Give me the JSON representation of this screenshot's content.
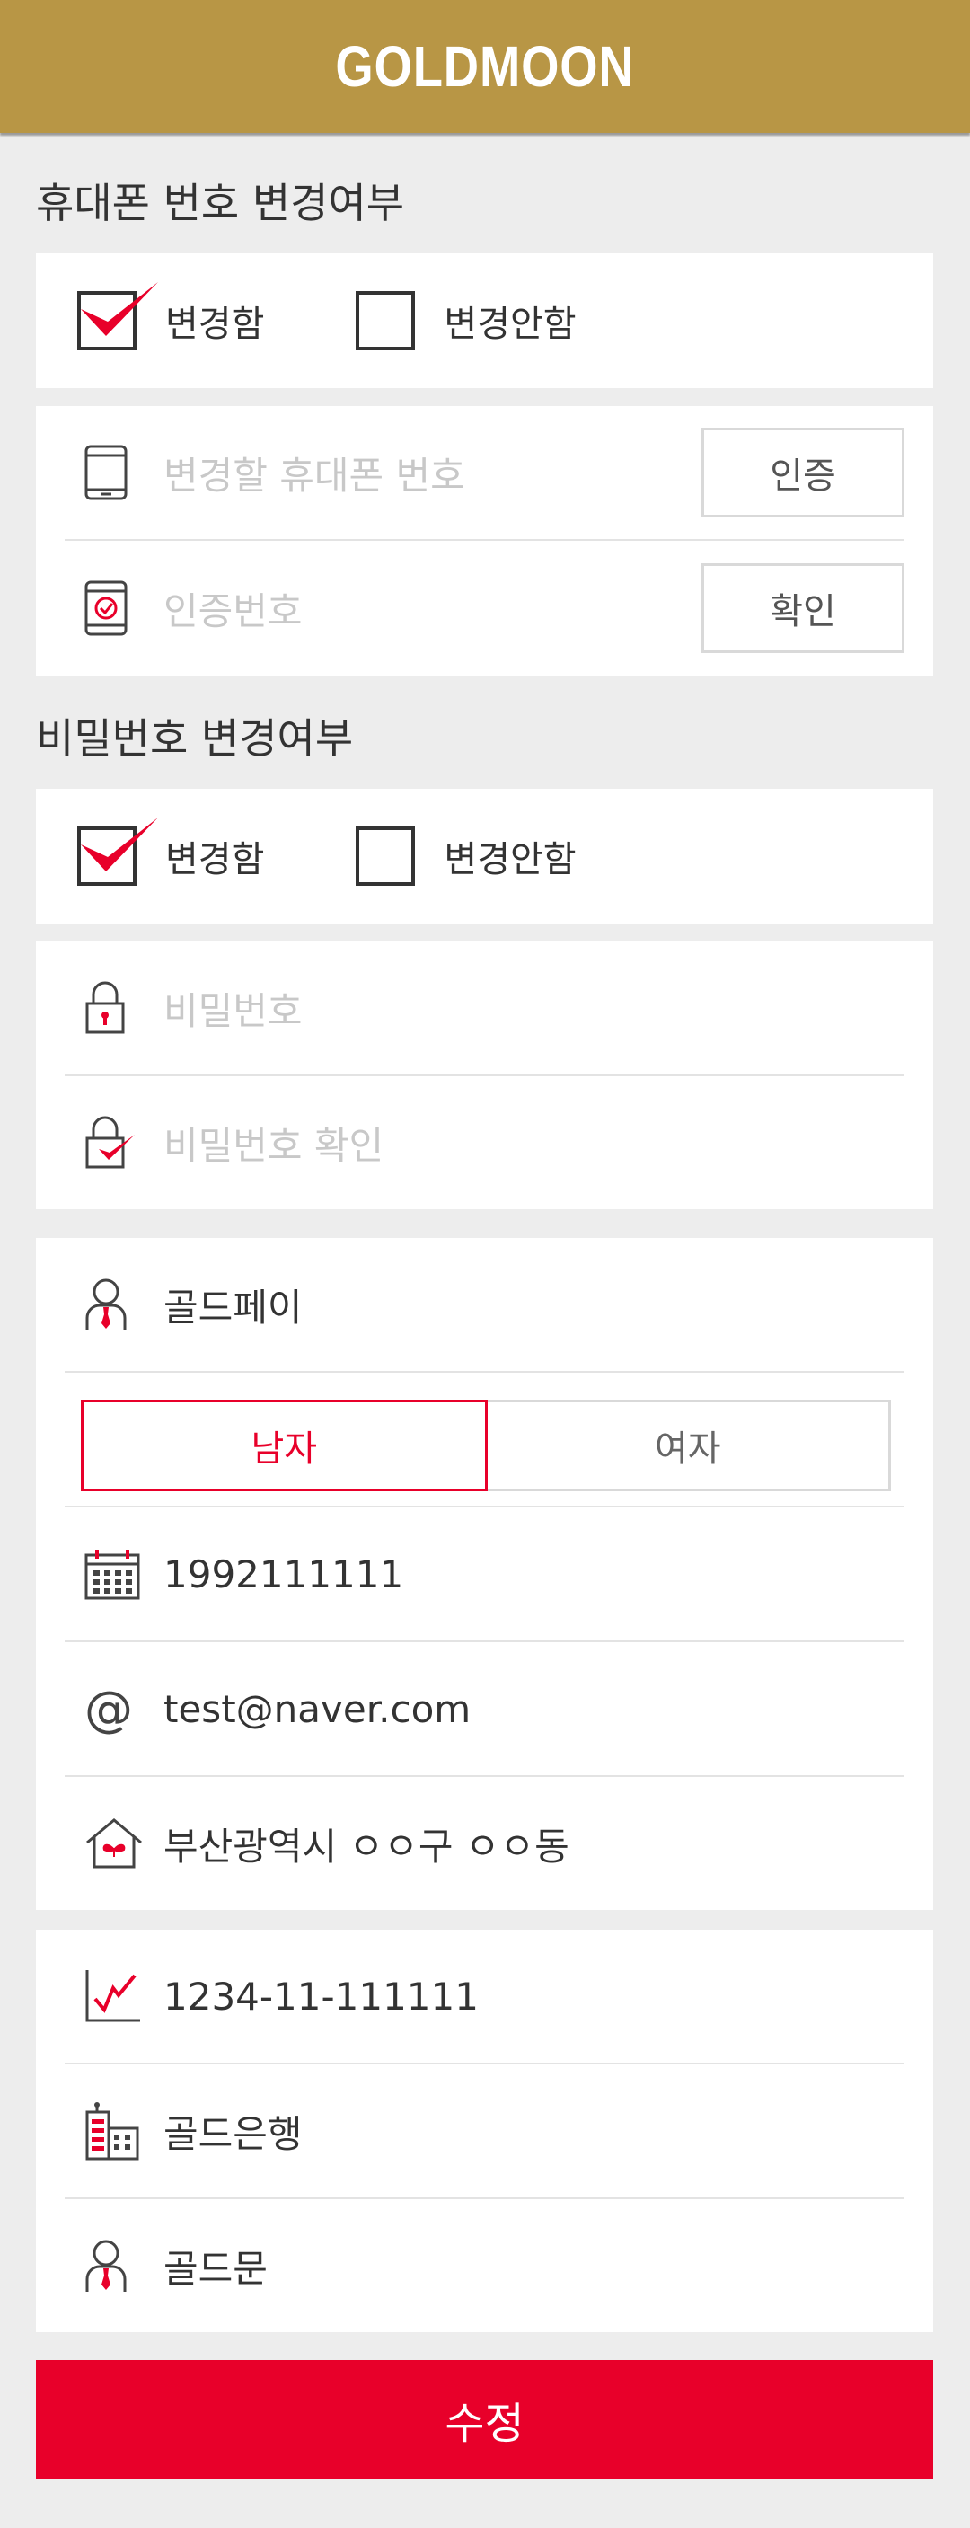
{
  "header": {
    "logo": "GOLDMOON"
  },
  "phone_change": {
    "title": "휴대폰 번호 변경여부",
    "option_change": "변경함",
    "option_no_change": "변경안함",
    "phone_placeholder": "변경할 휴대폰 번호",
    "verify_button": "인증",
    "code_placeholder": "인증번호",
    "confirm_button": "확인"
  },
  "password_change": {
    "title": "비밀번호 변경여부",
    "option_change": "변경함",
    "option_no_change": "변경안함",
    "password_placeholder": "비밀번호",
    "password_confirm_placeholder": "비밀번호 확인"
  },
  "profile": {
    "name": "골드페이",
    "gender_male": "남자",
    "gender_female": "여자",
    "selected_gender": "남자",
    "birthdate": "1992111111",
    "email": "test@naver.com",
    "address": "부산광역시 ㅇㅇ구 ㅇㅇ동"
  },
  "bank": {
    "account_number": "1234-11-111111",
    "bank_name": "골드은행",
    "holder_name": "골드문"
  },
  "submit_label": "수정",
  "colors": {
    "brand_gold": "#b89645",
    "accent_red": "#e8002a",
    "background": "#ededed"
  }
}
